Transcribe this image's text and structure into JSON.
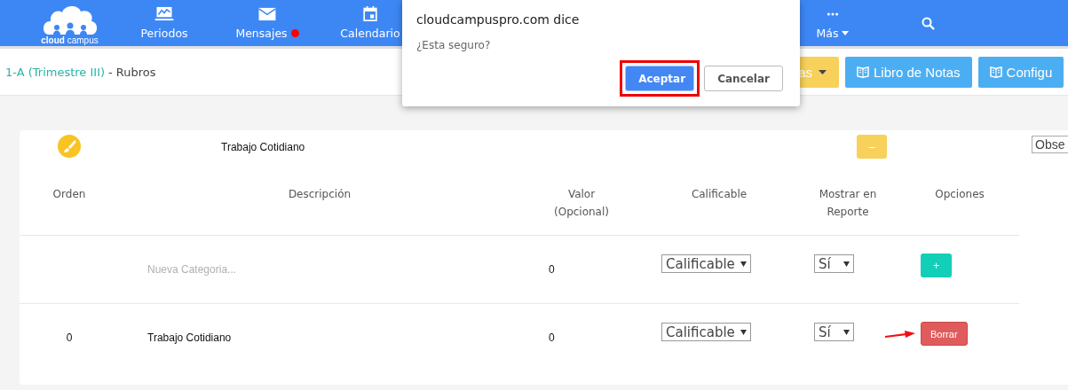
{
  "navbar": {
    "logo": "**cloud** campus",
    "items": [
      {
        "label": "Periodos",
        "kind": "chart",
        "notification": false
      },
      {
        "label": "Mensajes",
        "kind": "mail",
        "notification": true
      },
      {
        "label": "Calendario",
        "kind": "calendar",
        "notification": false
      }
    ],
    "more": {
      "label": "Más"
    }
  },
  "breadcrumb": {
    "link": "1-A (Trimestre III)",
    "separator": "-",
    "current": "Rubros"
  },
  "toolbar": [
    {
      "label": "as",
      "color": "#f8d15a",
      "kind": "dropdown"
    },
    {
      "label": "Libro de Notas",
      "color": "#4caef2",
      "kind": "book"
    },
    {
      "label": "Configu",
      "color": "#4caef2",
      "kind": "book"
    }
  ],
  "dialog": {
    "title": "cloudcampuspro.com dice",
    "message": "¿Esta seguro?",
    "buttons": [
      {
        "label": "Aceptar",
        "primary": true,
        "highlighted": true
      },
      {
        "label": "Cancelar",
        "primary": false,
        "highlighted": false
      }
    ]
  },
  "category": {
    "title": "Trabajo Cotidiano",
    "collapse_button": "–",
    "observation_select": "Obse"
  },
  "table": {
    "columns": [
      "Orden",
      "Descripción",
      "Valor (Opcional)",
      "Calificable",
      "Mostrar en Reporte",
      "Opciones"
    ],
    "rows": [
      {
        "kind": "new",
        "placeholder": "Nueva Categoria...",
        "value": "0",
        "grading": "Calificable",
        "show": "Sí",
        "action": "+",
        "pointer_arrow": false
      },
      {
        "kind": "existing",
        "order": "0",
        "description": "Trabajo Cotidiano",
        "value": "0",
        "grading": "Calificable",
        "show": "Sí",
        "action": "Borrar",
        "pointer_arrow": true
      }
    ]
  }
}
